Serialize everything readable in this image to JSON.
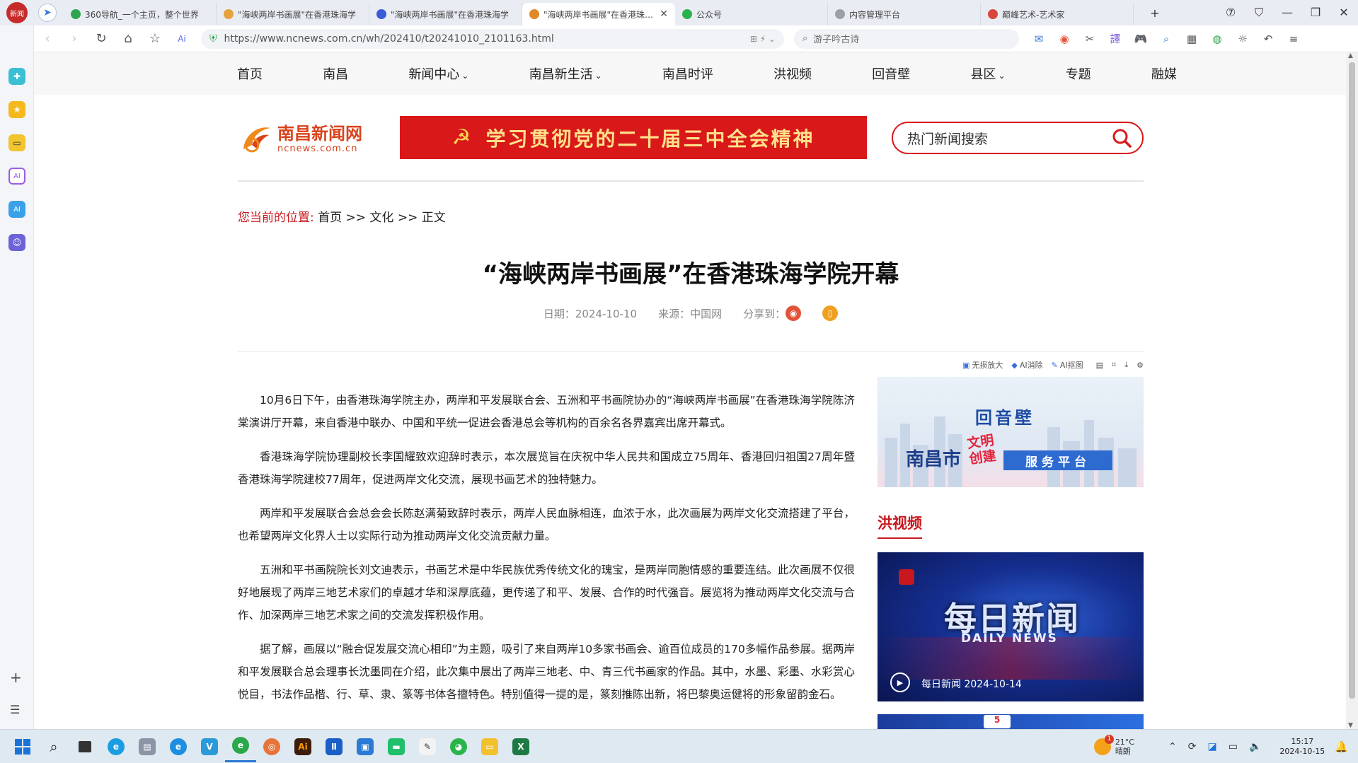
{
  "browser": {
    "app_badge": "新闻",
    "tabs": [
      {
        "label": "360导航_一个主页，整个世界",
        "color": "#2da44e",
        "active": false
      },
      {
        "label": "\"海峡两岸书画展\"在香港珠海学",
        "color": "#e6a23c",
        "active": false
      },
      {
        "label": "\"海峡两岸书画展\"在香港珠海学",
        "color": "#3a5bd6",
        "active": false
      },
      {
        "label": "\"海峡两岸书画展\"在香港珠海学",
        "color": "#e0892b",
        "active": true
      },
      {
        "label": "公众号",
        "color": "#29b24c",
        "active": false
      },
      {
        "label": "内容管理平台",
        "color": "#9aa0a6",
        "active": false
      },
      {
        "label": "巅峰艺术-艺术家",
        "color": "#d9473a",
        "active": false
      }
    ],
    "new_tab": "+",
    "url": "https://www.ncnews.com.cn/wh/202410/t20241010_2101163.html",
    "url_right": "⊞  ⚡  ⌄",
    "search_value": "游子吟古诗",
    "win_controls": [
      "⑦",
      "⛉",
      "—",
      "❐",
      "✕"
    ]
  },
  "site": {
    "nav": [
      "首页",
      "南昌",
      "新闻中心",
      "南昌新生活",
      "南昌时评",
      "洪视频",
      "回音壁",
      "县区",
      "专题",
      "融媒"
    ],
    "nav_dropdown": [
      false,
      false,
      true,
      true,
      false,
      false,
      false,
      true,
      false,
      false
    ],
    "logo_cn": "南昌新闻网",
    "logo_en": "ncnews.com.cn",
    "banner_text": "学习贯彻党的二十届三中全会精神",
    "search_placeholder": "热门新闻搜索"
  },
  "breadcrumb": {
    "lead": "您当前的位置:",
    "path": " 首页 >> 文化 >> 正文"
  },
  "article": {
    "title": "“海峡两岸书画展”在香港珠海学院开幕",
    "date": "日期：2024-10-10",
    "source": "来源：中国网",
    "share": "分享到：",
    "paragraphs": [
      "10月6日下午，由香港珠海学院主办，两岸和平发展联合会、五洲和平书画院协办的“海峡两岸书画展”在香港珠海学院陈济棠演讲厅开幕，来自香港中联办、中国和平统一促进会香港总会等机构的百余名各界嘉宾出席开幕式。",
      "香港珠海学院协理副校长李国耀致欢迎辞时表示，本次展览旨在庆祝中华人民共和国成立75周年、香港回归祖国27周年暨香港珠海学院建校77周年，促进两岸文化交流，展现书画艺术的独特魅力。",
      "两岸和平发展联合会总会会长陈赵满菊致辞时表示，两岸人民血脉相连，血浓于水，此次画展为两岸文化交流搭建了平台，也希望两岸文化界人士以实际行动为推动两岸文化交流贡献力量。",
      "五洲和平书画院院长刘文迪表示，书画艺术是中华民族优秀传统文化的瑰宝，是两岸同胞情感的重要连结。此次画展不仅很好地展现了两岸三地艺术家们的卓越才华和深厚底蕴，更传递了和平、发展、合作的时代强音。展览将为推动两岸文化交流与合作、加深两岸三地艺术家之间的交流发挥积极作用。",
      "据了解，画展以“融合促发展交流心相印”为主题，吸引了来自两岸10多家书画会、逾百位成员的170多幅作品参展。据两岸和平发展联合总会理事长沈墨同在介绍，此次集中展出了两岸三地老、中、青三代书画家的作品。其中，水墨、彩墨、水彩赏心悦目，书法作品楷、行、草、隶、篆等书体各擅特色。特别值得一提的是，篆刻推陈出新，将巴黎奥运健将的形象留韵金石。"
    ]
  },
  "sidebar_right": {
    "img_tools": [
      "无损放大",
      "AI消除",
      "AI抠图"
    ],
    "ad_huiyinbi": "回音壁",
    "ad_nanchang": "南昌市",
    "ad_wenming": "文明创建",
    "ad_service": "服务平台",
    "section_title": "洪视频",
    "video_title_cn": "每日新闻",
    "video_title_en": "DAILY NEWS",
    "video_caption": "每日新闻 2024-10-14",
    "video2_badge": "5"
  },
  "taskbar": {
    "weather_temp": "21°C",
    "weather_desc": "晴朗",
    "weather_badge": "1",
    "time": "15:17",
    "date": "2024-10-15"
  }
}
